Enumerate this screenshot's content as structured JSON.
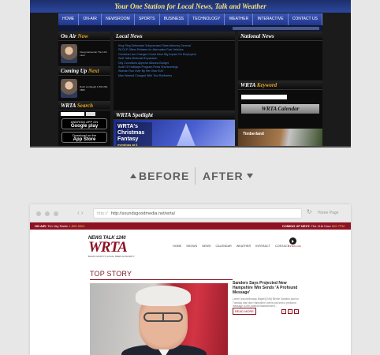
{
  "before": {
    "banner": "Your One Station for Local News, Talk and Weather",
    "nav": [
      "HOME",
      "ON-AIR",
      "NEWSROOM",
      "SPORTS",
      "BUSINESS",
      "TECHNOLOGY",
      "WEATHER",
      "INTERACTIVE",
      "CONTACT US"
    ],
    "on_air": {
      "heading_white": "On Air ",
      "heading_accent": "Now",
      "host_text": "Doug Heineman The 11th Hour"
    },
    "coming_up": {
      "heading_white": "Coming Up ",
      "heading_accent": "Next",
      "host_text": "Rush Limbaugh 1 800 282 2882"
    },
    "search": {
      "heading_white": "WRTA ",
      "heading_accent": "Search",
      "button": "Search"
    },
    "store_badges": [
      {
        "top": "ANDROID APP ON",
        "name": "Google play"
      },
      {
        "top": "Download on the",
        "name": "App Store"
      }
    ],
    "local_news": {
      "heading": "Local News",
      "items": [
        "King Ring Defendant Subpoenaed State Attorney General",
        "PA DLP Offers Rebates for Alternative Fuel Vehicles",
        "Omnibus Law Changes Could Have Big Impact On Employers",
        "Wolf Talks Medicaid Expansion",
        "City Councilors Approve Altoona Budget",
        "Audit Of Hollidays Program Finds Shortcomings",
        "Woman Run Over By Her Own SUV",
        "Man Wanted Charged With Two Robberies"
      ]
    },
    "spotlight": {
      "heading": "WRTA Spotlight",
      "title": "WRTA's Christmas Fantasy",
      "sub": "evenings at 6"
    },
    "national_news": {
      "heading": "National News"
    },
    "keyword": {
      "heading_white": "WRTA ",
      "heading_accent": "Keyword"
    },
    "calendar": {
      "heading": "WRTA Calendar"
    },
    "ad_text": "Timberland"
  },
  "divider": {
    "before": "BEFORE",
    "after": "AFTER"
  },
  "after": {
    "url_protocol": "http://",
    "url_host": "http://soundsgoodmedia.net/wrta/",
    "home_page": "Home Page",
    "on_air_label": "ON AIR:",
    "on_air_value": "Tim Vay Radio",
    "on_air_phone": "1-800-9001",
    "coming_up_label": "COMING UP NEXT:",
    "coming_up_value": "The 11th Hour",
    "coming_up_time": "MM 7PM",
    "logo_top": "NEWS TALK 1240",
    "logo_main": "WRTA",
    "logo_tagline": "BLAIR COUNTY'S LOCAL NEWS AUTHORITY",
    "nav": [
      "HOME",
      "SHOWS",
      "NEWS",
      "CALENDAR",
      "WEATHER",
      "INTERACT",
      "CONTACT"
    ],
    "listen_label": "LISTEN LIVE",
    "section_title": "TOP STORY",
    "story_headline": "Sanders Says Projected New Hampshire Win Sends 'A Profound Message'",
    "story_body": "Lorem Ipsum/Monday Bright/(CNN) Bernie Sanders said on Tuesday that New Hampshire voters had sent a profound message to the political establishment...",
    "read_more": "READ MORE",
    "share_icons": [
      "f",
      "t",
      "+"
    ]
  }
}
